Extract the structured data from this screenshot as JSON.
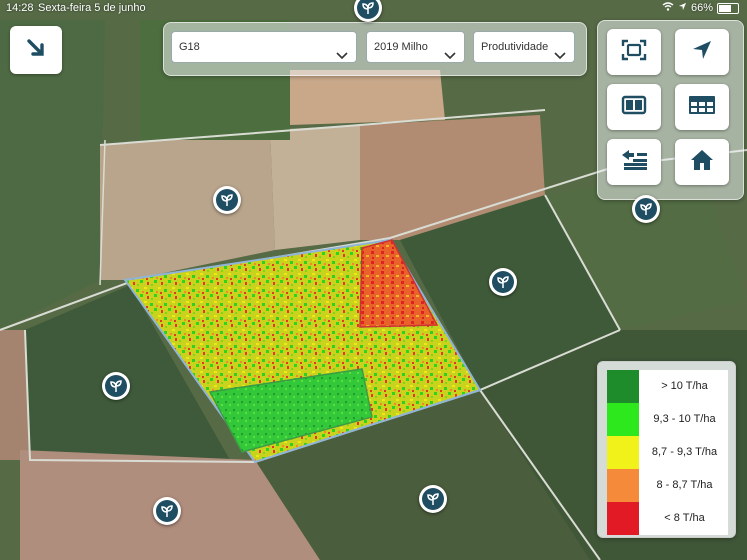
{
  "status_bar": {
    "time": "14:28",
    "date": "Sexta-feira 5 de junho",
    "battery": "66%"
  },
  "filters": {
    "field": "G18",
    "season": "2019 Milho",
    "layer": "Produtividade"
  },
  "toolbar_icons": [
    "expand-icon",
    "locate-icon",
    "split-view-icon",
    "table-icon",
    "layers-back-icon",
    "home-icon"
  ],
  "legend": {
    "items": [
      {
        "label": "> 10 T/ha",
        "color": "#1e8c2a"
      },
      {
        "label": "9,3 - 10 T/ha",
        "color": "#2ee81e"
      },
      {
        "label": "8,7 - 9,3 T/ha",
        "color": "#f0f21a"
      },
      {
        "label": "8 - 8,7 T/ha",
        "color": "#f58a3a"
      },
      {
        "label": "< 8 T/ha",
        "color": "#e11a25"
      }
    ]
  },
  "map_pins": [
    "plant-icon"
  ]
}
